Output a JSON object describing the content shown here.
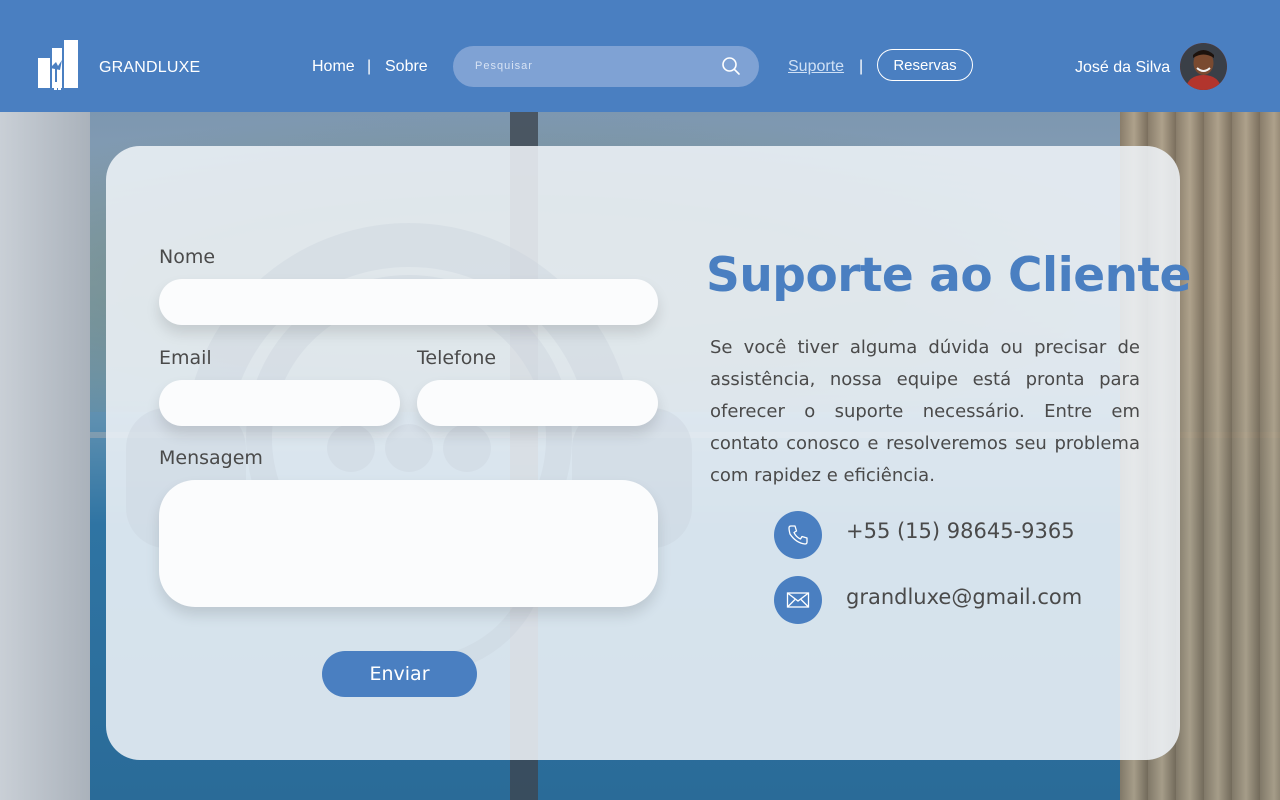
{
  "header": {
    "brand": "GRANDLUXE",
    "nav": {
      "home": "Home",
      "sobre": "Sobre",
      "suporte": "Suporte",
      "separator": "|"
    },
    "search": {
      "placeholder": "Pesquisar"
    },
    "reservas_label": "Reservas",
    "user_name": "José da Silva"
  },
  "form": {
    "nome_label": "Nome",
    "email_label": "Email",
    "telefone_label": "Telefone",
    "mensagem_label": "Mensagem",
    "submit_label": "Enviar"
  },
  "info": {
    "title": "Suporte ao Cliente",
    "description": "Se você tiver alguma dúvida ou precisar de assistência, nossa equipe está pronta para oferecer o suporte necessário. Entre em contato conosco e resolveremos seu problema com rapidez e eficiência.",
    "phone": "+55 (15) 98645-9365",
    "email": "grandluxe@gmail.com"
  },
  "colors": {
    "accent": "#4a7fc1",
    "text": "#4a4a4a",
    "card": "#eef2f7"
  },
  "icons": [
    "hotel-logo-icon",
    "search-icon",
    "avatar",
    "phone-icon",
    "mail-icon",
    "support-headset-icon"
  ]
}
